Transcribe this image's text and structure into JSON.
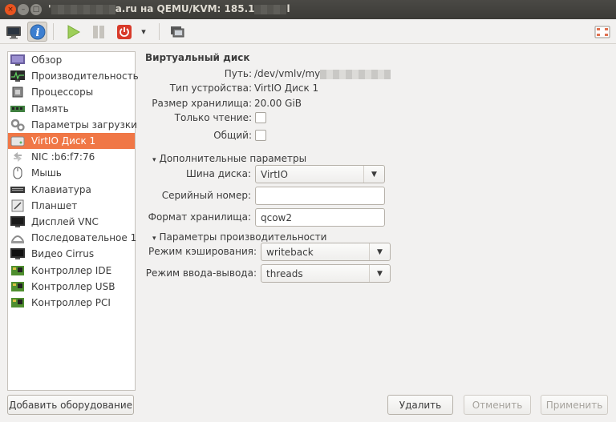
{
  "window": {
    "title_prefix": "'",
    "title_suffix": "a.ru на QEMU/KVM: 185.1",
    "title_end": "l",
    "close_glyph": "×",
    "min_glyph": "–",
    "max_glyph": "□"
  },
  "toolbar": {
    "buttons": [
      "console-monitor-icon",
      "info-icon",
      "run-icon",
      "pause-icon",
      "power-icon",
      "dropdown-arrow-icon",
      "screenshot-icon",
      "fullscreen-icon"
    ],
    "info_glyph": "i",
    "dropdown_glyph": "▾"
  },
  "sidebar": {
    "items": [
      {
        "label": "Обзор",
        "icon": "overview-icon"
      },
      {
        "label": "Производительность",
        "icon": "performance-icon"
      },
      {
        "label": "Процессоры",
        "icon": "cpu-icon"
      },
      {
        "label": "Память",
        "icon": "memory-icon"
      },
      {
        "label": "Параметры загрузки",
        "icon": "boot-options-icon"
      },
      {
        "label": "VirtIO Диск 1",
        "icon": "disk-icon",
        "selected": true
      },
      {
        "label": "NIC :b6:f7:76",
        "icon": "nic-icon"
      },
      {
        "label": "Мышь",
        "icon": "mouse-icon"
      },
      {
        "label": "Клавиатура",
        "icon": "keyboard-icon"
      },
      {
        "label": "Планшет",
        "icon": "tablet-icon"
      },
      {
        "label": "Дисплей VNC",
        "icon": "display-icon"
      },
      {
        "label": "Последовательное 1",
        "icon": "serial-icon"
      },
      {
        "label": "Видео Cirrus",
        "icon": "video-icon"
      },
      {
        "label": "Контроллер IDE",
        "icon": "controller-icon"
      },
      {
        "label": "Контроллер USB",
        "icon": "controller-icon"
      },
      {
        "label": "Контроллер PCI",
        "icon": "controller-icon"
      }
    ],
    "add_hardware": "Добавить оборудование"
  },
  "disk": {
    "heading": "Виртуальный диск",
    "path_label": "Путь:",
    "path_value": "/dev/vmlv/my",
    "device_type_label": "Тип устройства:",
    "device_type_value": "VirtIO Диск 1",
    "storage_size_label": "Размер хранилища:",
    "storage_size_value": "20.00 GiB",
    "readonly_label": "Только чтение:",
    "readonly_checked": false,
    "shared_label": "Общий:",
    "shared_checked": false
  },
  "advanced": {
    "section_label": "Дополнительные параметры",
    "bus_label": "Шина диска:",
    "bus_value": "VirtIO",
    "serial_label": "Серийный номер:",
    "serial_value": "",
    "format_label": "Формат хранилища:",
    "format_value": "qcow2"
  },
  "performance": {
    "section_label": "Параметры производительности",
    "cache_label": "Режим кэширования:",
    "cache_value": "writeback",
    "io_label": "Режим ввода-вывода:",
    "io_value": "threads"
  },
  "expander_glyph": "▾",
  "buttons": {
    "remove": "Удалить",
    "cancel": "Отменить",
    "apply": "Применить"
  },
  "colors": {
    "selection": "#f07746",
    "titlebar": "#3c3b37",
    "close_button": "#e9541f"
  }
}
